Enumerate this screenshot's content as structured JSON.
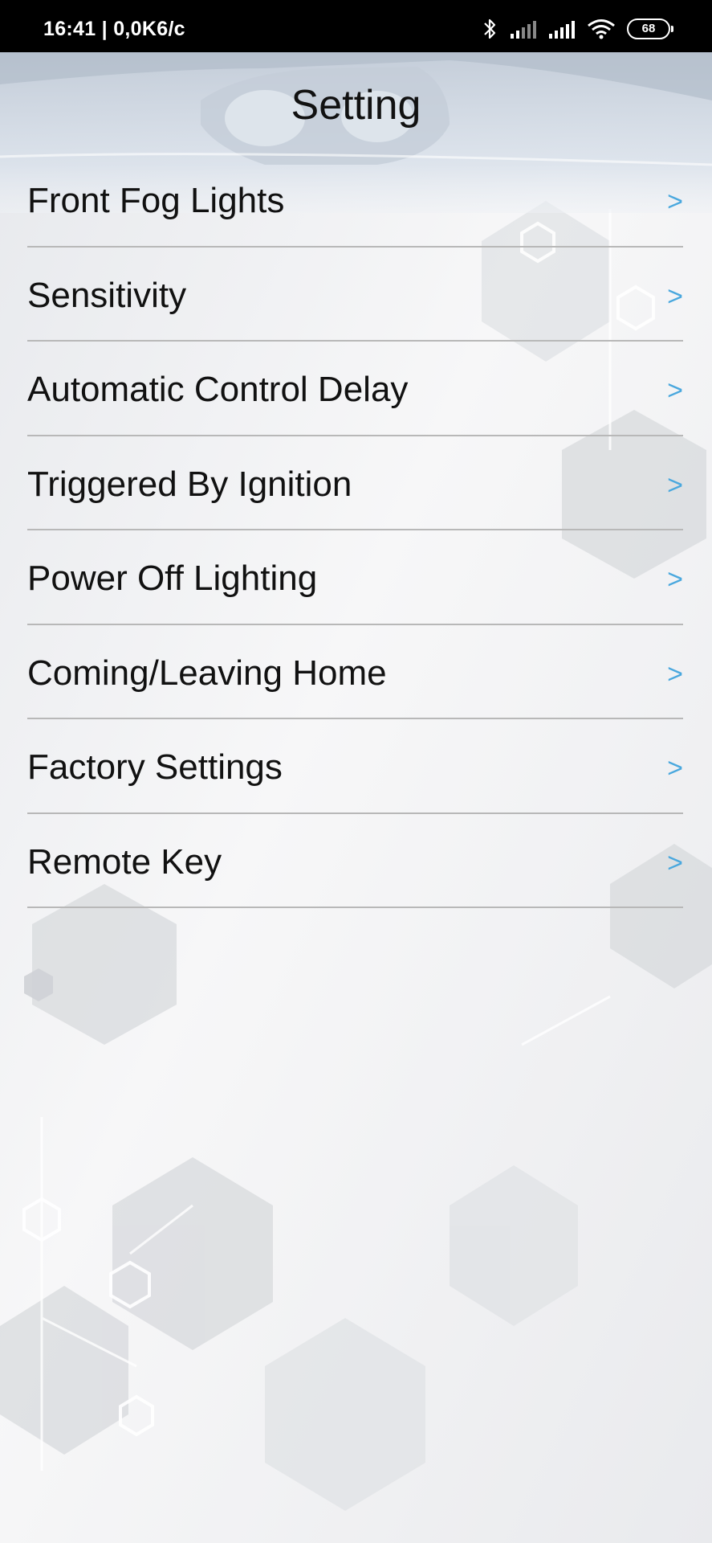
{
  "status_bar": {
    "time": "16:41 | 0,0K6/c",
    "battery": "68"
  },
  "header": {
    "title": "Setting"
  },
  "menu": {
    "items": [
      {
        "label": "Front Fog Lights",
        "arrow": ">"
      },
      {
        "label": "Sensitivity",
        "arrow": ">"
      },
      {
        "label": "Automatic Control Delay",
        "arrow": ">"
      },
      {
        "label": "Triggered By Ignition",
        "arrow": ">"
      },
      {
        "label": "Power Off Lighting",
        "arrow": ">"
      },
      {
        "label": "Coming/Leaving Home",
        "arrow": ">"
      },
      {
        "label": "Factory Settings",
        "arrow": ">"
      },
      {
        "label": "Remote Key",
        "arrow": ">"
      }
    ]
  },
  "colors": {
    "arrow": "#4aa8de",
    "divider": "#b8b8b8",
    "text": "#111111",
    "status_bar": "#000000"
  },
  "icons": [
    "bluetooth-icon",
    "signal-icon",
    "signal-icon",
    "wifi-icon",
    "battery-icon",
    "chevron-right-icon"
  ]
}
